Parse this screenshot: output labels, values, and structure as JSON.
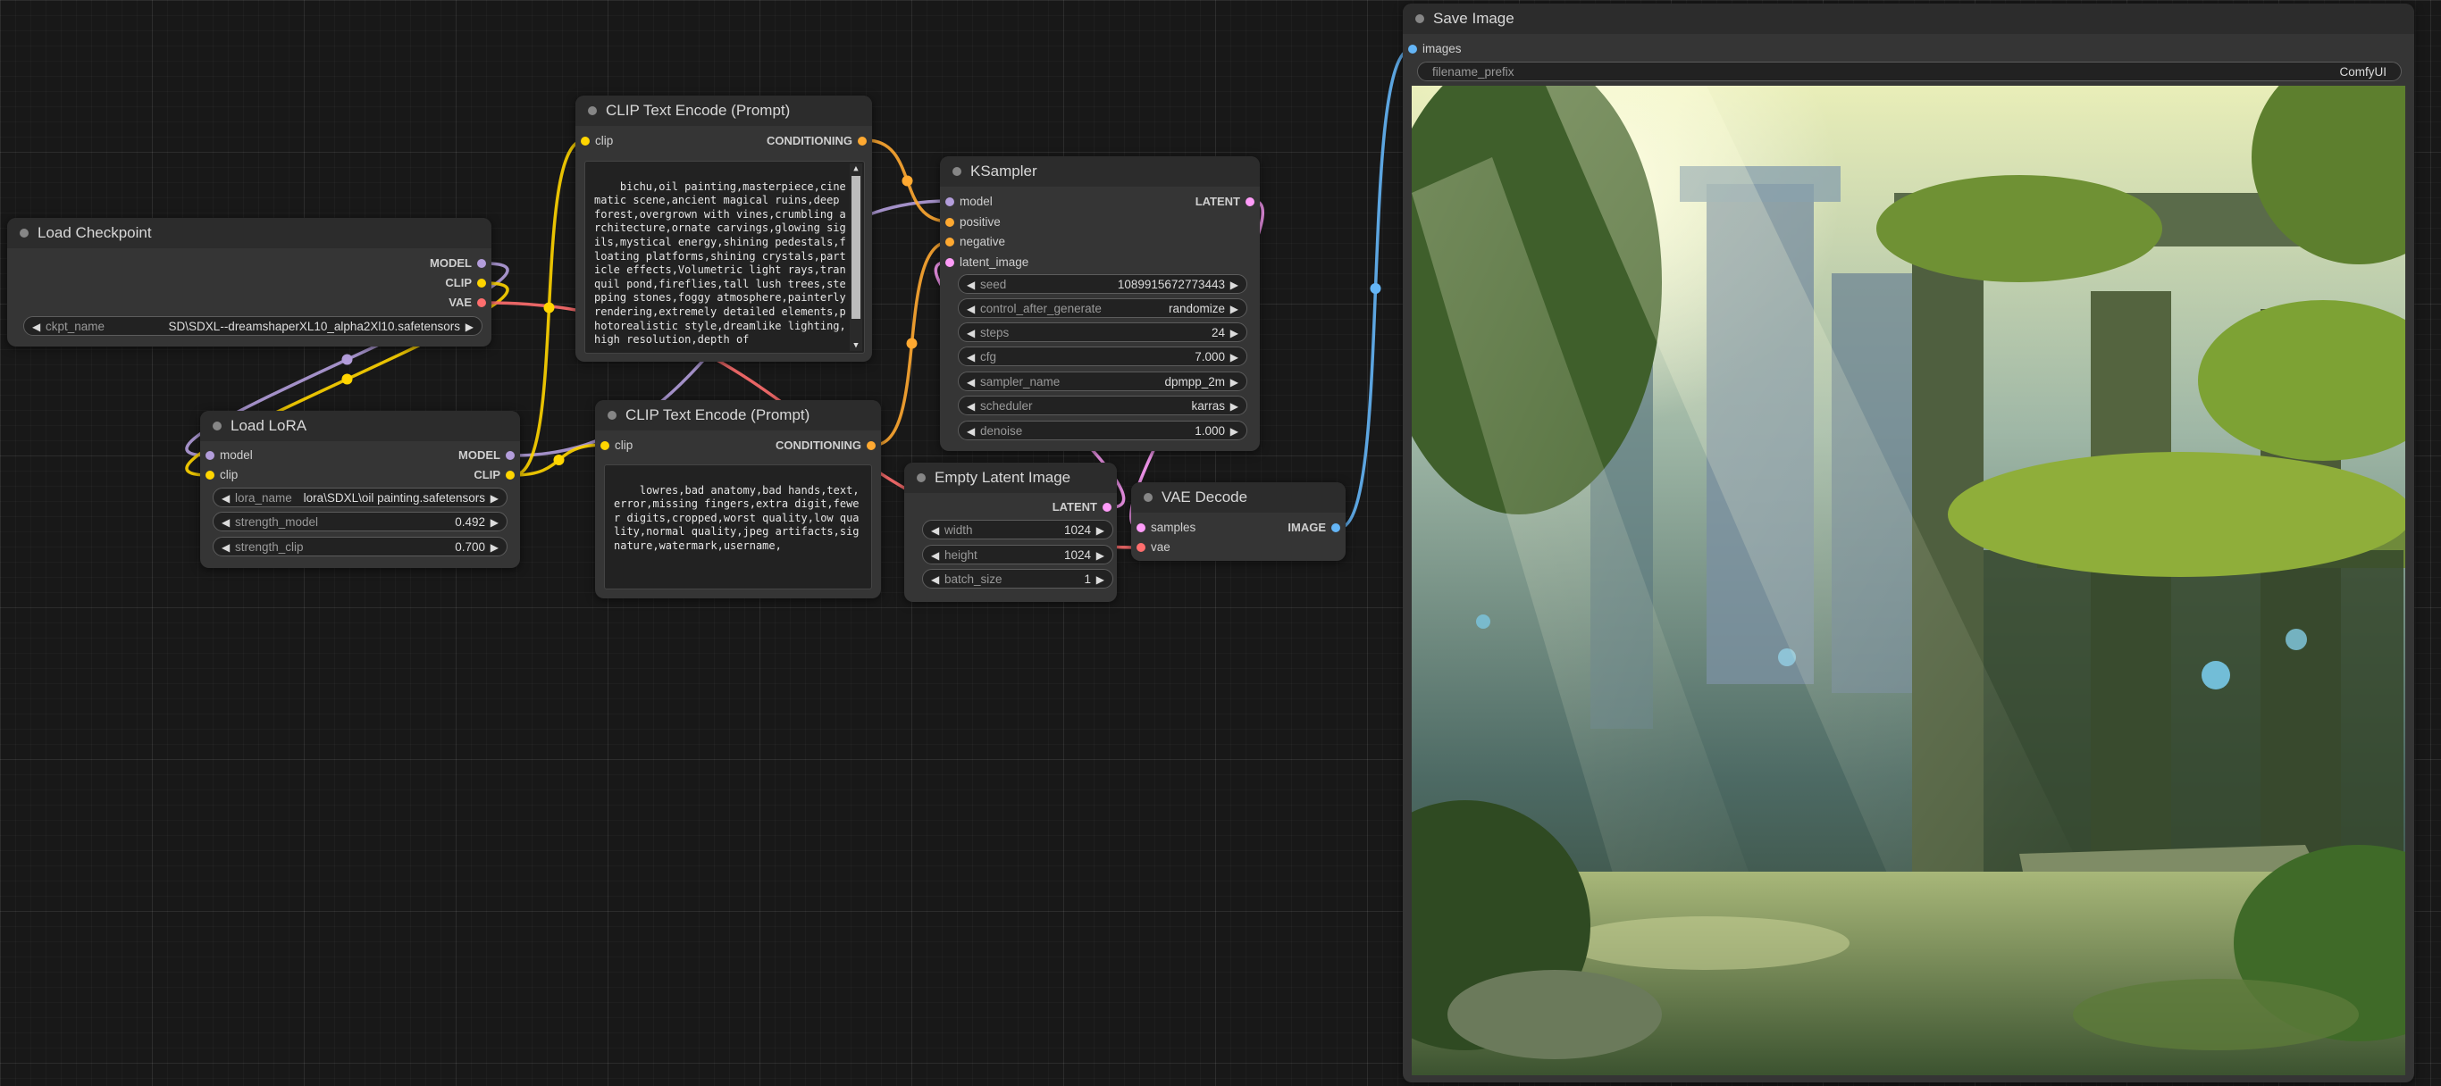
{
  "colors": {
    "model": "#b39ddb",
    "clip": "#ffd500",
    "vae": "#ff6e6e",
    "conditioning": "#ffa931",
    "latent": "#ff9cf9",
    "image": "#64b5f6"
  },
  "nodes": {
    "load_checkpoint": {
      "title": "Load Checkpoint",
      "outputs": [
        "MODEL",
        "CLIP",
        "VAE"
      ],
      "ckpt_label": "ckpt_name",
      "ckpt_value": "SD\\SDXL--dreamshaperXL10_alpha2Xl10.safetensors"
    },
    "load_lora": {
      "title": "Load LoRA",
      "inputs": [
        "model",
        "clip"
      ],
      "outputs": [
        "MODEL",
        "CLIP"
      ],
      "lora_label": "lora_name",
      "lora_value": "lora\\SDXL\\oil painting.safetensors",
      "strength_model_label": "strength_model",
      "strength_model_value": "0.492",
      "strength_clip_label": "strength_clip",
      "strength_clip_value": "0.700"
    },
    "clip_positive": {
      "title": "CLIP Text Encode (Prompt)",
      "input": "clip",
      "output": "CONDITIONING",
      "text": "bichu,oil painting,masterpiece,cinematic scene,ancient magical ruins,deep forest,overgrown with vines,crumbling architecture,ornate carvings,glowing sigils,mystical energy,shining pedestals,floating platforms,shining crystals,particle effects,Volumetric light rays,tranquil pond,fireflies,tall lush trees,stepping stones,foggy atmosphere,painterly rendering,extremely detailed elements,photorealistic style,dreamlike lighting,high resolution,depth of"
    },
    "clip_negative": {
      "title": "CLIP Text Encode (Prompt)",
      "input": "clip",
      "output": "CONDITIONING",
      "text": "lowres,bad anatomy,bad hands,text,error,missing fingers,extra digit,fewer digits,cropped,worst quality,low quality,normal quality,jpeg artifacts,signature,watermark,username,"
    },
    "ksampler": {
      "title": "KSampler",
      "inputs": [
        "model",
        "positive",
        "negative",
        "latent_image"
      ],
      "output": "LATENT",
      "widgets": [
        {
          "label": "seed",
          "value": "1089915672773443"
        },
        {
          "label": "control_after_generate",
          "value": "randomize"
        },
        {
          "label": "steps",
          "value": "24"
        },
        {
          "label": "cfg",
          "value": "7.000"
        },
        {
          "label": "sampler_name",
          "value": "dpmpp_2m"
        },
        {
          "label": "scheduler",
          "value": "karras"
        },
        {
          "label": "denoise",
          "value": "1.000"
        }
      ]
    },
    "empty_latent": {
      "title": "Empty Latent Image",
      "output": "LATENT",
      "widgets": [
        {
          "label": "width",
          "value": "1024"
        },
        {
          "label": "height",
          "value": "1024"
        },
        {
          "label": "batch_size",
          "value": "1"
        }
      ]
    },
    "vae_decode": {
      "title": "VAE Decode",
      "inputs": [
        "samples",
        "vae"
      ],
      "output": "IMAGE"
    },
    "save_image": {
      "title": "Save Image",
      "input": "images",
      "prefix_label": "filename_prefix",
      "prefix_value": "ComfyUI"
    }
  },
  "widget_arrows": {
    "left": "◀",
    "right": "▶"
  }
}
